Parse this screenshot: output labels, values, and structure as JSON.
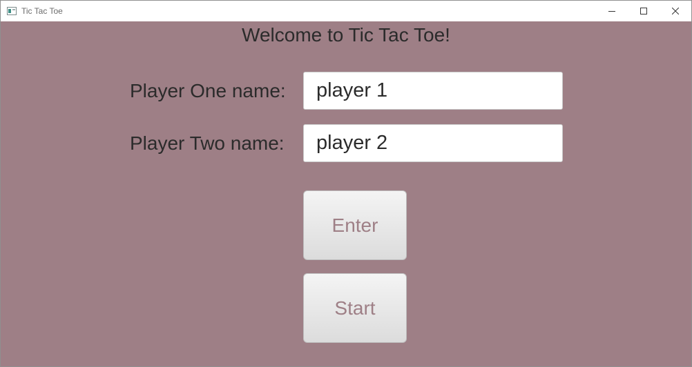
{
  "window": {
    "title": "Tic Tac Toe",
    "controls": [
      "minimize-icon",
      "maximize-icon",
      "close-icon"
    ]
  },
  "main": {
    "welcome": "Welcome to Tic Tac Toe!",
    "player_one_label": "Player One name:",
    "player_one_value": "player 1",
    "player_two_label": "Player Two name:",
    "player_two_value": "player 2",
    "enter_label": "Enter",
    "start_label": "Start"
  },
  "colors": {
    "background": "#9e7f86",
    "button_text": "#9e7f86",
    "text": "#2b2b2b"
  }
}
